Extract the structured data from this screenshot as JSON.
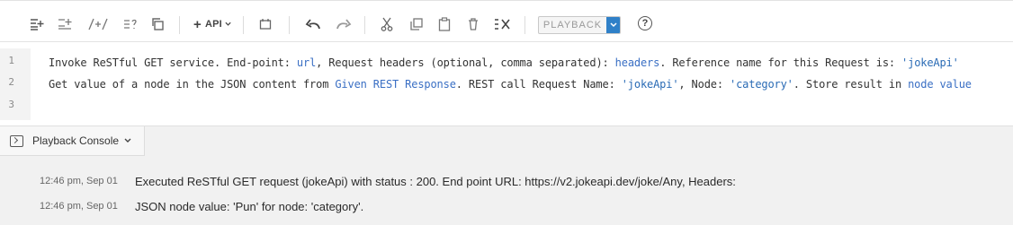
{
  "toolbar": {
    "api_label": "API",
    "playback_label": "PLAYBACK",
    "help_label": "?"
  },
  "editor": {
    "line_numbers": [
      "1",
      "2",
      "3"
    ],
    "lines": [
      {
        "p1": "Invoke ReSTful GET service. End-point: ",
        "a1": "url",
        "p2": ", Request headers (optional, comma separated): ",
        "a2": "headers",
        "p3": ". Reference name for this Request is: ",
        "a3": "'jokeApi'"
      },
      {
        "p1": "Get value of a node in the JSON content from ",
        "a1": "Given REST Response",
        "p2": ". REST call Request Name: ",
        "a2": "'jokeApi'",
        "p3": ", Node: ",
        "a3": "'category'",
        "p4": ". Store result in ",
        "a4": "node value"
      }
    ]
  },
  "console": {
    "title": "Playback Console",
    "logs": [
      {
        "time": "12:46 pm, Sep 01",
        "message": "Executed ReSTful GET request (jokeApi) with status : 200. End point URL: https://v2.jokeapi.dev/joke/Any, Headers:"
      },
      {
        "time": "12:46 pm, Sep 01",
        "message": "JSON node value: 'Pun' for node: 'category'."
      }
    ]
  },
  "colors": {
    "accent": "#2f80c8",
    "argument": "#3a6fc4"
  }
}
